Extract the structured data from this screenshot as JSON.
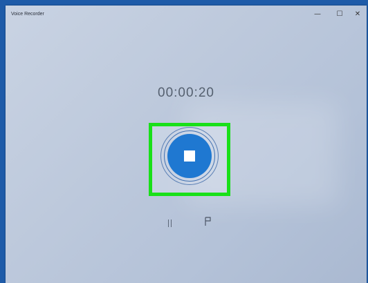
{
  "window": {
    "title": "Voice Recorder",
    "controls": {
      "minimize_icon": "—",
      "maximize_icon": "☐",
      "close_icon": "✕"
    }
  },
  "recorder": {
    "elapsed": "00:00:20",
    "stop_icon": "stop-icon",
    "pause_icon": "pause-icon",
    "marker_icon": "flag-icon"
  },
  "colors": {
    "accent": "#1f78d1",
    "highlight": "#19e019",
    "taskbar": "#1e5ba8"
  }
}
